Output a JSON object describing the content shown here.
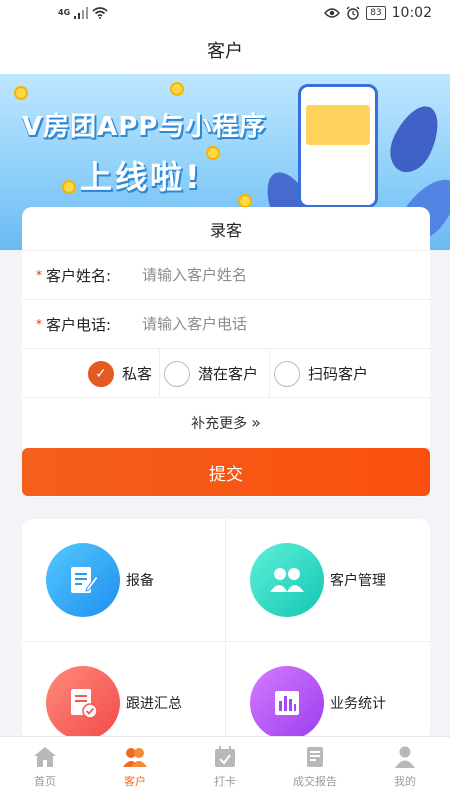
{
  "statusbar": {
    "network": "4G",
    "battery": "83",
    "time": "10:02"
  },
  "header": {
    "title": "客户"
  },
  "banner": {
    "line1": "V房团APP与小程序",
    "line2": "上线啦!"
  },
  "form": {
    "title": "录客",
    "name_label": "客户姓名:",
    "name_placeholder": "请输入客户姓名",
    "phone_label": "客户电话:",
    "phone_placeholder": "请输入客户电话",
    "required_mark": "*",
    "types": [
      {
        "label": "私客",
        "checked": true
      },
      {
        "label": "潜在客户",
        "checked": false
      },
      {
        "label": "扫码客户",
        "checked": false
      }
    ],
    "more_label": "补充更多",
    "submit_label": "提交"
  },
  "menu": [
    {
      "label": "报备",
      "icon": "report-icon"
    },
    {
      "label": "客户管理",
      "icon": "customer-manage-icon"
    },
    {
      "label": "跟进汇总",
      "icon": "followup-icon"
    },
    {
      "label": "业务统计",
      "icon": "stats-icon"
    }
  ],
  "tabs": [
    {
      "label": "首页",
      "icon": "home-icon",
      "active": false
    },
    {
      "label": "客户",
      "icon": "customer-icon",
      "active": true
    },
    {
      "label": "打卡",
      "icon": "checkin-icon",
      "active": false
    },
    {
      "label": "成交报告",
      "icon": "deal-report-icon",
      "active": false
    },
    {
      "label": "我的",
      "icon": "profile-icon",
      "active": false
    }
  ],
  "colors": {
    "accent": "#f26a21",
    "submit": "#f65a16",
    "required": "#e8321e"
  }
}
